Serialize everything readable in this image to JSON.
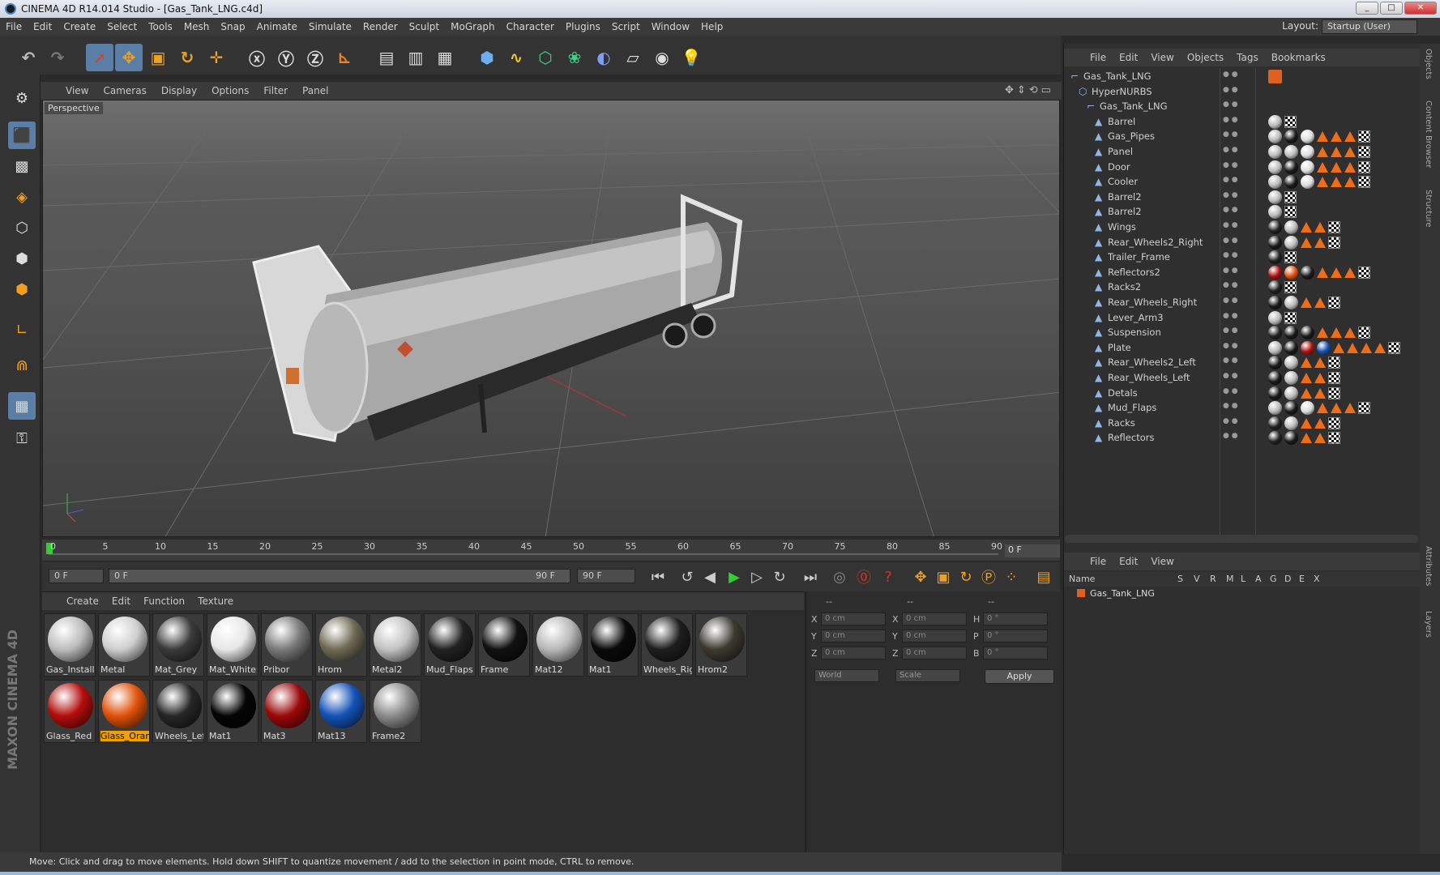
{
  "window": {
    "title": "CINEMA 4D R14.014 Studio - [Gas_Tank_LNG.c4d]"
  },
  "menubar": [
    "File",
    "Edit",
    "Create",
    "Select",
    "Tools",
    "Mesh",
    "Snap",
    "Animate",
    "Simulate",
    "Render",
    "Sculpt",
    "MoGraph",
    "Character",
    "Plugins",
    "Script",
    "Window",
    "Help"
  ],
  "layout": {
    "label": "Layout:",
    "value": "Startup (User)"
  },
  "viewport": {
    "menu": [
      "View",
      "Cameras",
      "Display",
      "Options",
      "Filter",
      "Panel"
    ],
    "label": "Perspective"
  },
  "timeline": {
    "ticks": [
      "0",
      "5",
      "10",
      "15",
      "20",
      "25",
      "30",
      "35",
      "40",
      "45",
      "50",
      "55",
      "60",
      "65",
      "70",
      "75",
      "80",
      "85",
      "90"
    ],
    "end_frame": "0 F",
    "start_field": "0 F",
    "range_start": "0 F",
    "range_end": "90 F",
    "end_field": "90 F"
  },
  "materials": {
    "menu": [
      "Create",
      "Edit",
      "Function",
      "Texture"
    ],
    "items": [
      {
        "name": "Gas_Install",
        "color": "#bdbdbd"
      },
      {
        "name": "Metal",
        "color": "#cfcfcf"
      },
      {
        "name": "Mat_Grey",
        "color": "#3a3a3a"
      },
      {
        "name": "Mat_White",
        "color": "#e8e8e8"
      },
      {
        "name": "Pribor",
        "color": "#7a7a7a"
      },
      {
        "name": "Hrom",
        "color": "#6f6a55"
      },
      {
        "name": "Metal2",
        "color": "#c2c2c2"
      },
      {
        "name": "Mud_Flaps",
        "color": "#222222"
      },
      {
        "name": "Frame",
        "color": "#111111"
      },
      {
        "name": "Mat12",
        "color": "#b8b8b8"
      },
      {
        "name": "Mat1",
        "color": "#0a0a0a"
      },
      {
        "name": "Wheels_Rig",
        "color": "#1e1e1e"
      },
      {
        "name": "Hrom2",
        "color": "#3c3a30"
      },
      {
        "name": "Glass_Red",
        "color": "#b40d0d"
      },
      {
        "name": "Glass_Oran",
        "color": "#e2520a"
      },
      {
        "name": "Wheels_Lef",
        "color": "#262626"
      },
      {
        "name": "Mat1",
        "color": "#050505"
      },
      {
        "name": "Mat3",
        "color": "#9c0909"
      },
      {
        "name": "Mat13",
        "color": "#1453b8"
      },
      {
        "name": "Frame2",
        "color": "#8c8c8c"
      }
    ],
    "active": "Glass_Oran"
  },
  "coordinates": {
    "headers": [
      "--",
      "--",
      "--"
    ],
    "rows": [
      {
        "a": "X",
        "av": "0 cm",
        "b": "X",
        "bv": "0 cm",
        "c": "H",
        "cv": "0 °"
      },
      {
        "a": "Y",
        "av": "0 cm",
        "b": "Y",
        "bv": "0 cm",
        "c": "P",
        "cv": "0 °"
      },
      {
        "a": "Z",
        "av": "0 cm",
        "b": "Z",
        "bv": "0 cm",
        "c": "B",
        "cv": "0 °"
      }
    ],
    "mode": "World",
    "scale": "Scale",
    "apply": "Apply"
  },
  "status": "Move: Click and drag to move elements. Hold down SHIFT to quantize movement / add to the selection in point mode, CTRL to remove.",
  "object_manager": {
    "menu": [
      "File",
      "Edit",
      "View",
      "Objects",
      "Tags",
      "Bookmarks"
    ],
    "objects": [
      {
        "name": "Gas_Tank_LNG",
        "indent": 0,
        "tags": "o"
      },
      {
        "name": "HyperNURBS",
        "indent": 1,
        "tags": ""
      },
      {
        "name": "Gas_Tank_LNG",
        "indent": 2,
        "tags": ""
      },
      {
        "name": "Barrel",
        "indent": 3,
        "tags": "gc"
      },
      {
        "name": "Gas_Pipes",
        "indent": 3,
        "tags": "gkwtttc"
      },
      {
        "name": "Panel",
        "indent": 3,
        "tags": "ggwtttc"
      },
      {
        "name": "Door",
        "indent": 3,
        "tags": "gkwtttc"
      },
      {
        "name": "Cooler",
        "indent": 3,
        "tags": "gkwtttc"
      },
      {
        "name": "Barrel2",
        "indent": 3,
        "tags": "gc"
      },
      {
        "name": "Barrel2",
        "indent": 3,
        "tags": "gc"
      },
      {
        "name": "Wings",
        "indent": 3,
        "tags": "fgttc"
      },
      {
        "name": "Rear_Wheels2_Right",
        "indent": 3,
        "tags": "kgttc"
      },
      {
        "name": "Trailer_Frame",
        "indent": 3,
        "tags": "fc"
      },
      {
        "name": "Reflectors2",
        "indent": 3,
        "tags": "roktttc"
      },
      {
        "name": "Racks2",
        "indent": 3,
        "tags": "fc"
      },
      {
        "name": "Rear_Wheels_Right",
        "indent": 3,
        "tags": "kgttc"
      },
      {
        "name": "Lever_Arm3",
        "indent": 3,
        "tags": "gc"
      },
      {
        "name": "Suspension",
        "indent": 3,
        "tags": "fkktttc"
      },
      {
        "name": "Plate",
        "indent": 3,
        "tags": "gkrbttttc"
      },
      {
        "name": "Rear_Wheels2_Left",
        "indent": 3,
        "tags": "kgttc"
      },
      {
        "name": "Rear_Wheels_Left",
        "indent": 3,
        "tags": "kgttc"
      },
      {
        "name": "Detals",
        "indent": 3,
        "tags": "kgttc"
      },
      {
        "name": "Mud_Flaps",
        "indent": 3,
        "tags": "gkwtttc"
      },
      {
        "name": "Racks",
        "indent": 3,
        "tags": "fgttc"
      },
      {
        "name": "Reflectors",
        "indent": 3,
        "tags": "fkttc"
      }
    ]
  },
  "attributes": {
    "menu": [
      "File",
      "Edit",
      "View"
    ],
    "headers": [
      "Name",
      "S",
      "V",
      "R",
      "M",
      "L",
      "A",
      "G",
      "D",
      "E",
      "X"
    ],
    "row": "Gas_Tank_LNG"
  },
  "side_tabs": [
    "Objects",
    "Content Browser",
    "Structure",
    "Attributes",
    "Layers"
  ]
}
